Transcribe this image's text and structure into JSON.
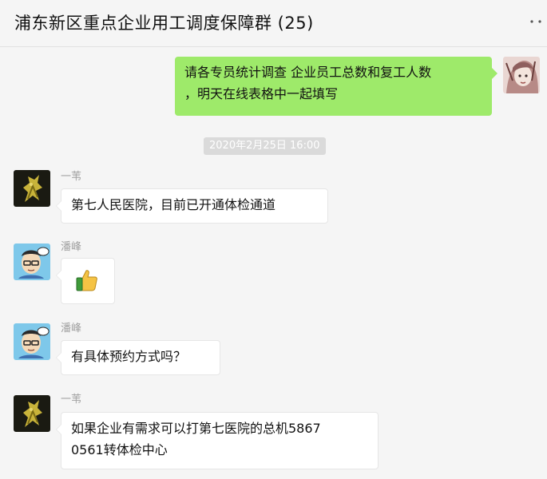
{
  "header": {
    "title": "浦东新区重点企业用工调度保障群 (25)",
    "more_icon": "more-dots-icon"
  },
  "messages": [
    {
      "direction": "out",
      "lines": [
        "请各专员统计调查 企业员工总数和复工人数",
        "，明天在线表格中一起填写"
      ]
    },
    {
      "direction": "in",
      "sender": "一苇",
      "lines": [
        "第七人民医院，目前已开通体检通道"
      ]
    },
    {
      "direction": "in",
      "sender": "潘峰",
      "emoji": "thumbs-up-emoji"
    },
    {
      "direction": "in",
      "sender": "潘峰",
      "lines": [
        "有具体预约方式吗？"
      ]
    },
    {
      "direction": "in",
      "sender": "一苇",
      "lines": [
        "如果企业有需求可以打第七医院的总机5867",
        "0561转体检中心"
      ]
    }
  ],
  "timestamp": "2020年2月25日 16:00",
  "colors": {
    "out_bubble": "#9eea6a",
    "in_bubble": "#ffffff",
    "background": "#f5f5f5"
  }
}
